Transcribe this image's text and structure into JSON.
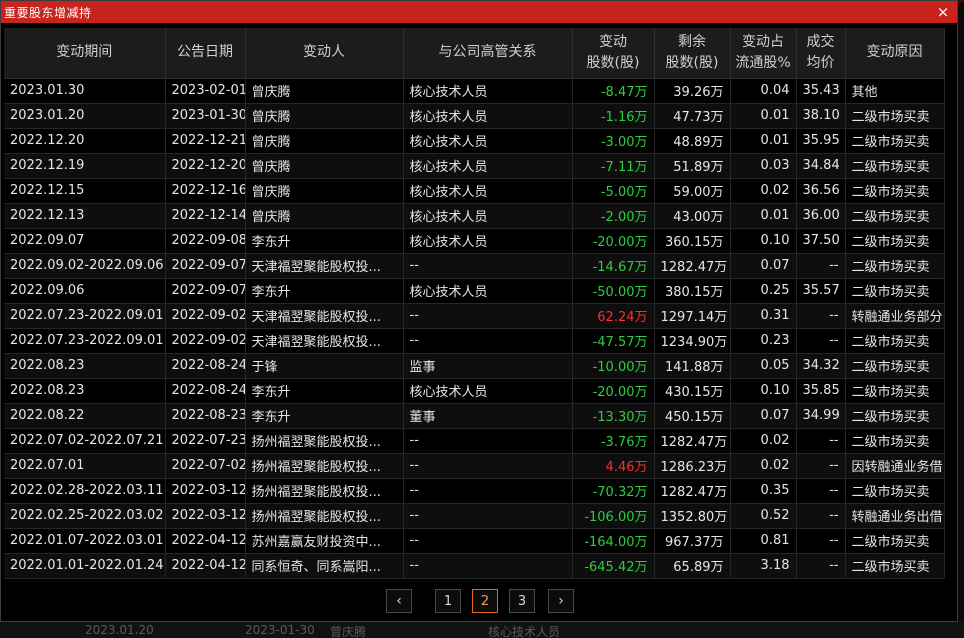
{
  "window": {
    "title": "重要股东增减持",
    "close_glyph": "×"
  },
  "columns": [
    {
      "l1": "变动期间",
      "l2": ""
    },
    {
      "l1": "公告日期",
      "l2": ""
    },
    {
      "l1": "变动人",
      "l2": ""
    },
    {
      "l1": "与公司高管关系",
      "l2": ""
    },
    {
      "l1": "变动",
      "l2": "股数(股)"
    },
    {
      "l1": "剩余",
      "l2": "股数(股)"
    },
    {
      "l1": "变动占",
      "l2": "流通股%"
    },
    {
      "l1": "成交",
      "l2": "均价"
    },
    {
      "l1": "变动原因",
      "l2": ""
    }
  ],
  "rows": [
    {
      "period": "2023.01.30",
      "date": "2023-02-01",
      "person": "曾庆腾",
      "relation": "核心技术人员",
      "change": "-8.47万",
      "remain": "39.26万",
      "pct": "0.04",
      "price": "35.43",
      "reason": "其他"
    },
    {
      "period": "2023.01.20",
      "date": "2023-01-30",
      "person": "曾庆腾",
      "relation": "核心技术人员",
      "change": "-1.16万",
      "remain": "47.73万",
      "pct": "0.01",
      "price": "38.10",
      "reason": "二级市场买卖"
    },
    {
      "period": "2022.12.20",
      "date": "2022-12-21",
      "person": "曾庆腾",
      "relation": "核心技术人员",
      "change": "-3.00万",
      "remain": "48.89万",
      "pct": "0.01",
      "price": "35.95",
      "reason": "二级市场买卖"
    },
    {
      "period": "2022.12.19",
      "date": "2022-12-20",
      "person": "曾庆腾",
      "relation": "核心技术人员",
      "change": "-7.11万",
      "remain": "51.89万",
      "pct": "0.03",
      "price": "34.84",
      "reason": "二级市场买卖"
    },
    {
      "period": "2022.12.15",
      "date": "2022-12-16",
      "person": "曾庆腾",
      "relation": "核心技术人员",
      "change": "-5.00万",
      "remain": "59.00万",
      "pct": "0.02",
      "price": "36.56",
      "reason": "二级市场买卖"
    },
    {
      "period": "2022.12.13",
      "date": "2022-12-14",
      "person": "曾庆腾",
      "relation": "核心技术人员",
      "change": "-2.00万",
      "remain": "43.00万",
      "pct": "0.01",
      "price": "36.00",
      "reason": "二级市场买卖"
    },
    {
      "period": "2022.09.07",
      "date": "2022-09-08",
      "person": "李东升",
      "relation": "核心技术人员",
      "change": "-20.00万",
      "remain": "360.15万",
      "pct": "0.10",
      "price": "37.50",
      "reason": "二级市场买卖"
    },
    {
      "period": "2022.09.02-2022.09.06",
      "date": "2022-09-07",
      "person": "天津福翌聚能股权投...",
      "relation": "--",
      "change": "-14.67万",
      "remain": "1282.47万",
      "pct": "0.07",
      "price": "--",
      "reason": "二级市场买卖"
    },
    {
      "period": "2022.09.06",
      "date": "2022-09-07",
      "person": "李东升",
      "relation": "核心技术人员",
      "change": "-50.00万",
      "remain": "380.15万",
      "pct": "0.25",
      "price": "35.57",
      "reason": "二级市场买卖"
    },
    {
      "period": "2022.07.23-2022.09.01",
      "date": "2022-09-02",
      "person": "天津福翌聚能股权投...",
      "relation": "--",
      "change": "62.24万",
      "remain": "1297.14万",
      "pct": "0.31",
      "price": "--",
      "reason": "转融通业务部分"
    },
    {
      "period": "2022.07.23-2022.09.01",
      "date": "2022-09-02",
      "person": "天津福翌聚能股权投...",
      "relation": "--",
      "change": "-47.57万",
      "remain": "1234.90万",
      "pct": "0.23",
      "price": "--",
      "reason": "二级市场买卖"
    },
    {
      "period": "2022.08.23",
      "date": "2022-08-24",
      "person": "于锋",
      "relation": "监事",
      "change": "-10.00万",
      "remain": "141.88万",
      "pct": "0.05",
      "price": "34.32",
      "reason": "二级市场买卖"
    },
    {
      "period": "2022.08.23",
      "date": "2022-08-24",
      "person": "李东升",
      "relation": "核心技术人员",
      "change": "-20.00万",
      "remain": "430.15万",
      "pct": "0.10",
      "price": "35.85",
      "reason": "二级市场买卖"
    },
    {
      "period": "2022.08.22",
      "date": "2022-08-23",
      "person": "李东升",
      "relation": "董事",
      "change": "-13.30万",
      "remain": "450.15万",
      "pct": "0.07",
      "price": "34.99",
      "reason": "二级市场买卖"
    },
    {
      "period": "2022.07.02-2022.07.21",
      "date": "2022-07-23",
      "person": "扬州福翌聚能股权投...",
      "relation": "--",
      "change": "-3.76万",
      "remain": "1282.47万",
      "pct": "0.02",
      "price": "--",
      "reason": "二级市场买卖"
    },
    {
      "period": "2022.07.01",
      "date": "2022-07-02",
      "person": "扬州福翌聚能股权投...",
      "relation": "--",
      "change": "4.46万",
      "remain": "1286.23万",
      "pct": "0.02",
      "price": "--",
      "reason": "因转融通业务借"
    },
    {
      "period": "2022.02.28-2022.03.11",
      "date": "2022-03-12",
      "person": "扬州福翌聚能股权投...",
      "relation": "--",
      "change": "-70.32万",
      "remain": "1282.47万",
      "pct": "0.35",
      "price": "--",
      "reason": "二级市场买卖"
    },
    {
      "period": "2022.02.25-2022.03.02",
      "date": "2022-03-12",
      "person": "扬州福翌聚能股权投...",
      "relation": "--",
      "change": "-106.00万",
      "remain": "1352.80万",
      "pct": "0.52",
      "price": "--",
      "reason": "转融通业务出借"
    },
    {
      "period": "2022.01.07-2022.03.01",
      "date": "2022-04-12",
      "person": "苏州嘉赢友财投资中...",
      "relation": "--",
      "change": "-164.00万",
      "remain": "967.37万",
      "pct": "0.81",
      "price": "--",
      "reason": "二级市场买卖"
    },
    {
      "period": "2022.01.01-2022.01.24",
      "date": "2022-04-12",
      "person": "同系恒奇、同系嵩阳...",
      "relation": "--",
      "change": "-645.42万",
      "remain": "65.89万",
      "pct": "3.18",
      "price": "--",
      "reason": "二级市场买卖"
    }
  ],
  "pagination": {
    "prev": "‹",
    "next": "›",
    "pages": [
      "1",
      "2",
      "3"
    ],
    "current": "2"
  },
  "background_row": {
    "period": "2023.01.20",
    "date": "2023-01-30",
    "person": "曾庆腾",
    "relation": "核心技术人员"
  },
  "colors": {
    "title_bar": "#c8241e",
    "negative": "#2ecc40",
    "positive": "#ff2b2b",
    "active_page": "#e0661f"
  }
}
